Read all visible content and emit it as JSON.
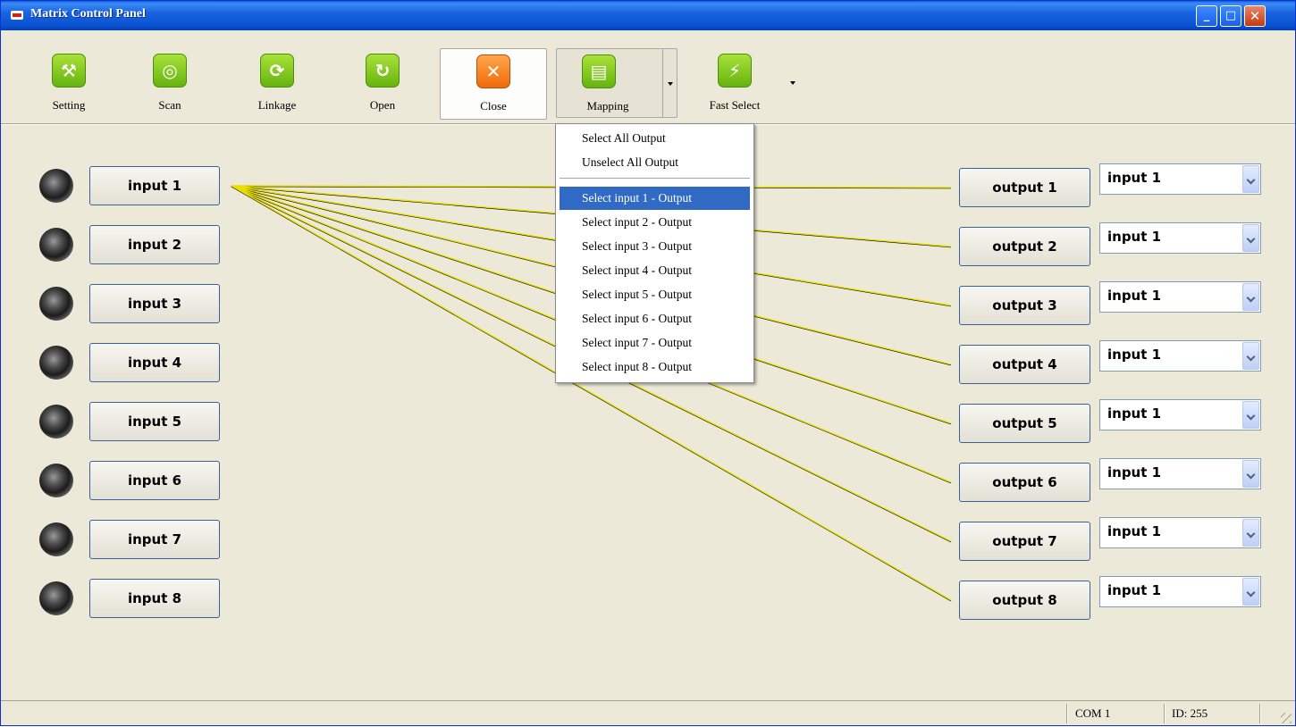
{
  "window": {
    "title": "Matrix Control Panel"
  },
  "toolbar": {
    "setting": "Setting",
    "scan": "Scan",
    "linkage": "Linkage",
    "open": "Open",
    "close": "Close",
    "mapping": "Mapping",
    "fast_select": "Fast Select"
  },
  "inputs": [
    "input 1",
    "input 2",
    "input 3",
    "input 4",
    "input 5",
    "input 6",
    "input 7",
    "input 8"
  ],
  "outputs": [
    {
      "label": "output 1",
      "source": "input 1"
    },
    {
      "label": "output 2",
      "source": "input 1"
    },
    {
      "label": "output 3",
      "source": "input 1"
    },
    {
      "label": "output 4",
      "source": "input 1"
    },
    {
      "label": "output 5",
      "source": "input 1"
    },
    {
      "label": "output 6",
      "source": "input 1"
    },
    {
      "label": "output 7",
      "source": "input 1"
    },
    {
      "label": "output 8",
      "source": "input 1"
    }
  ],
  "mapping_menu": {
    "items": [
      "Select All Output",
      "Unselect All Output",
      "Select input 1 - Output",
      "Select input 2 - Output",
      "Select input 3 - Output",
      "Select input 4 - Output",
      "Select input 5 - Output",
      "Select input 6 - Output",
      "Select input 7 - Output",
      "Select input 8 - Output"
    ],
    "highlighted": "Select input 1 - Output"
  },
  "statusbar": {
    "port": "COM 1",
    "id": "ID: 255"
  },
  "colors": {
    "link_line": "#e8e000",
    "menu_highlight": "#316ac5",
    "titlebar": "#0852d0"
  }
}
